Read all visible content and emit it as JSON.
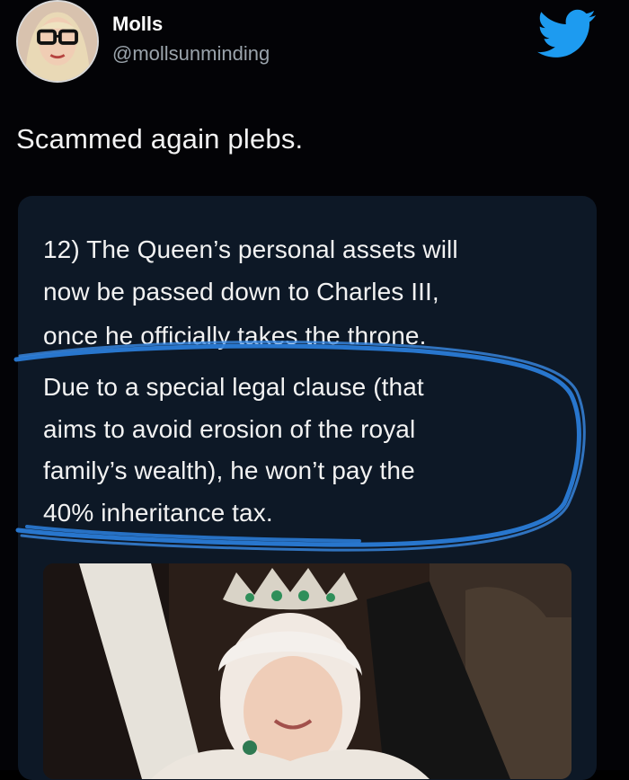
{
  "tweet": {
    "author_name": "Molls",
    "author_handle": "@mollsunminding",
    "text": "Scammed again plebs.",
    "avatar_icon": "profile-avatar",
    "brand_icon": "twitter-bird-icon",
    "brand_color": "#1d9bf0"
  },
  "quoted": {
    "lines": [
      "12) The Queen’s personal assets will",
      "now be passed down to Charles III,",
      "once he officially takes the throne.",
      "Due to a special legal clause (that",
      "aims to avoid erosion of the royal",
      "family’s wealth), he won’t pay the",
      "40% inheritance tax."
    ],
    "highlight_color": "#2a7bd6",
    "image_icon": "queen-photo"
  }
}
